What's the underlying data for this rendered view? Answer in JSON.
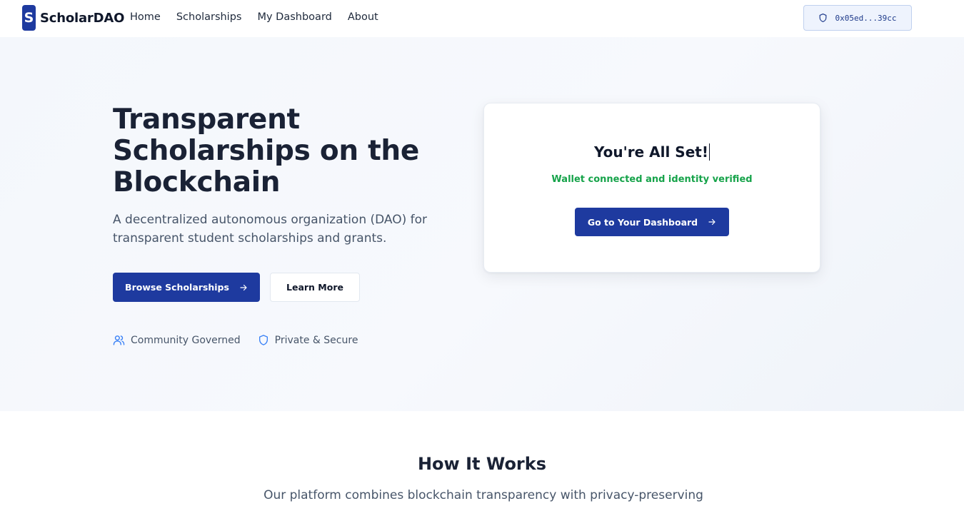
{
  "nav": {
    "logo_letter": "S",
    "brand": "ScholarDAO",
    "links": [
      "Home",
      "Scholarships",
      "My Dashboard",
      "About"
    ],
    "wallet_address": "0x05ed...39cc",
    "wallet_icon": "shield-icon"
  },
  "hero": {
    "title": "Transparent Scholarships on the Blockchain",
    "subtitle": "A decentralized autonomous organization (DAO) for transparent student scholarships and grants.",
    "primary_button": "Browse Scholarships",
    "secondary_button": "Learn More",
    "features": [
      {
        "icon": "users-icon",
        "label": "Community Governed"
      },
      {
        "icon": "shield-icon",
        "label": "Private & Secure"
      }
    ]
  },
  "card": {
    "title": "You're All Set!",
    "status": "Wallet connected and identity verified",
    "button": "Go to Your Dashboard"
  },
  "how_it_works": {
    "title": "How It Works",
    "subtitle": "Our platform combines blockchain transparency with privacy-preserving"
  },
  "colors": {
    "primary": "#1e3a9f",
    "success": "#16a34a",
    "feature_icon": "#3b82f6"
  }
}
